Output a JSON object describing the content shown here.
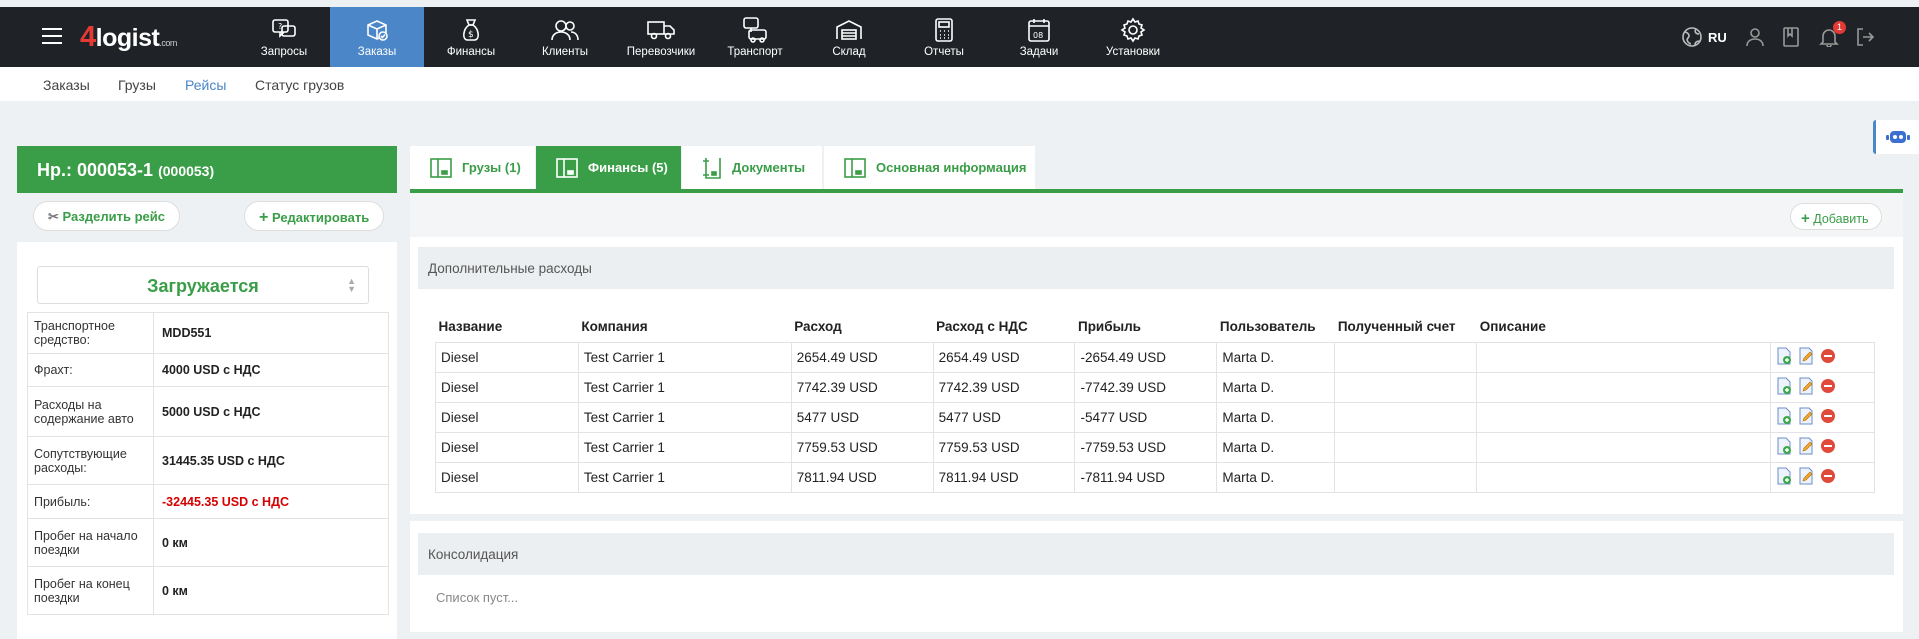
{
  "brand": {
    "four": "4",
    "name": "logist",
    "suffix": ".com"
  },
  "nav": [
    {
      "label": "Запросы",
      "icon": "requests-icon"
    },
    {
      "label": "Заказы",
      "icon": "orders-icon",
      "active": true
    },
    {
      "label": "Финансы",
      "icon": "money-bag-icon"
    },
    {
      "label": "Клиенты",
      "icon": "clients-icon"
    },
    {
      "label": "Перевозчики",
      "icon": "truck-icon"
    },
    {
      "label": "Транспорт",
      "icon": "transport-icon"
    },
    {
      "label": "Склад",
      "icon": "warehouse-icon"
    },
    {
      "label": "Отчеты",
      "icon": "calculator-icon"
    },
    {
      "label": "Задачи",
      "icon": "calendar-icon"
    },
    {
      "label": "Установки",
      "icon": "gear-icon"
    }
  ],
  "topright": {
    "lang": "RU",
    "notif_count": "1"
  },
  "subnav": [
    "Заказы",
    "Грузы",
    "Рейсы",
    "Статус грузов"
  ],
  "trip": {
    "title": "Нр.: 000053-1",
    "code": "(000053)",
    "split_label": "Разделить рейс",
    "edit_label": "Редактировать",
    "status": "Загружается",
    "info": [
      {
        "k": "Транспортное средство:",
        "v": "MDD551"
      },
      {
        "k": "Фрахт:",
        "v": "4000 USD с НДС"
      },
      {
        "k": "Расходы на содержание авто",
        "v": "5000 USD с НДС"
      },
      {
        "k": "Сопутствующие расходы:",
        "v": "31445.35 USD с НДС"
      },
      {
        "k": "Прибыль:",
        "v": "-32445.35 USD с НДС",
        "negative": true
      },
      {
        "k": "Пробег на начало поездки",
        "v": "0 км"
      },
      {
        "k": "Пробег на конец поездки",
        "v": "0 км"
      }
    ]
  },
  "tabs": [
    {
      "label": "Грузы (1)"
    },
    {
      "label": "Финансы (5)",
      "active": true
    },
    {
      "label": "Документы"
    },
    {
      "label": "Основная информация"
    }
  ],
  "finance": {
    "add_label": "Добавить",
    "section_title": "Дополнительные расходы",
    "columns": [
      "Название",
      "Компания",
      "Расход",
      "Расход с НДС",
      "Прибыль",
      "Пользователь",
      "Полученный счет",
      "Описание"
    ],
    "rows": [
      [
        "Diesel",
        "Test Carrier 1",
        "2654.49 USD",
        "2654.49 USD",
        "-2654.49 USD",
        "Marta D.",
        "",
        ""
      ],
      [
        "Diesel",
        "Test Carrier 1",
        "7742.39 USD",
        "7742.39 USD",
        "-7742.39 USD",
        "Marta D.",
        "",
        ""
      ],
      [
        "Diesel",
        "Test Carrier 1",
        "5477 USD",
        "5477 USD",
        "-5477 USD",
        "Marta D.",
        "",
        ""
      ],
      [
        "Diesel",
        "Test Carrier 1",
        "7759.53 USD",
        "7759.53 USD",
        "-7759.53 USD",
        "Marta D.",
        "",
        ""
      ],
      [
        "Diesel",
        "Test Carrier 1",
        "7811.94 USD",
        "7811.94 USD",
        "-7811.94 USD",
        "Marta D.",
        "",
        ""
      ]
    ]
  },
  "consolidation": {
    "title": "Консолидация",
    "empty": "Список пуст..."
  },
  "colors": {
    "green": "#3a9d47",
    "blue": "#4a86c8",
    "dark": "#1f2327",
    "negative": "#d50000"
  }
}
